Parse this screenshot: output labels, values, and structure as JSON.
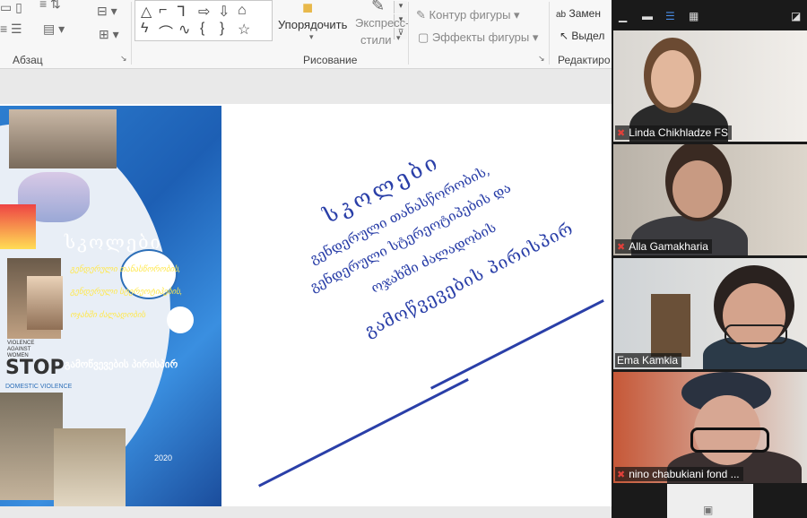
{
  "ribbon": {
    "paragraph_label": "Абзац",
    "drawing_label": "Рисование",
    "arrange_label": "Упорядочить",
    "quick_styles_label_1": "Экспресс-",
    "quick_styles_label_2": "стили",
    "shape_outline_label": "Контур фигуры",
    "shape_effects_label": "Эффекты фигуры",
    "replace_label": "Замен",
    "select_label": "Выдел",
    "editing_label": "Редактиро"
  },
  "slide": {
    "cover": {
      "title": "სკოლები",
      "subtitle_1": "გენდერული თანასწორობის,",
      "subtitle_2": "გენდერული სტერეოტიპების,",
      "subtitle_3": "ოჯახში ძალადობის",
      "footer": "გამოწვევების პირისპირ",
      "stop_top_1": "VIOLENCE",
      "stop_top_2": "AGAINST",
      "stop_top_3": "WOMEN",
      "stop_word": "STOP",
      "stop_sub": "DOMESTIC VIOLENCE",
      "year": "2020"
    },
    "text": {
      "line1": "სკოლები",
      "line2": "გენდერული თანასწორობის,",
      "line3": "გენდერული სტერეოტიპების და",
      "line4": "ოჯახში ძალადობის",
      "line5": "გამოწვევების პირისპირ"
    },
    "text_color": "#2a3fa8"
  },
  "participants": [
    {
      "name": "Linda Chikhladze FS",
      "muted": true
    },
    {
      "name": "Alla Gamakharia",
      "muted": true
    },
    {
      "name": "Ema Kamkia",
      "muted": false
    },
    {
      "name": "nino chabukiani fond ...",
      "muted": true
    }
  ],
  "colors": {
    "muted_mic": "#e0403a",
    "panel_bg": "#1a1a1a",
    "accent_blue": "#2d7ed0"
  }
}
